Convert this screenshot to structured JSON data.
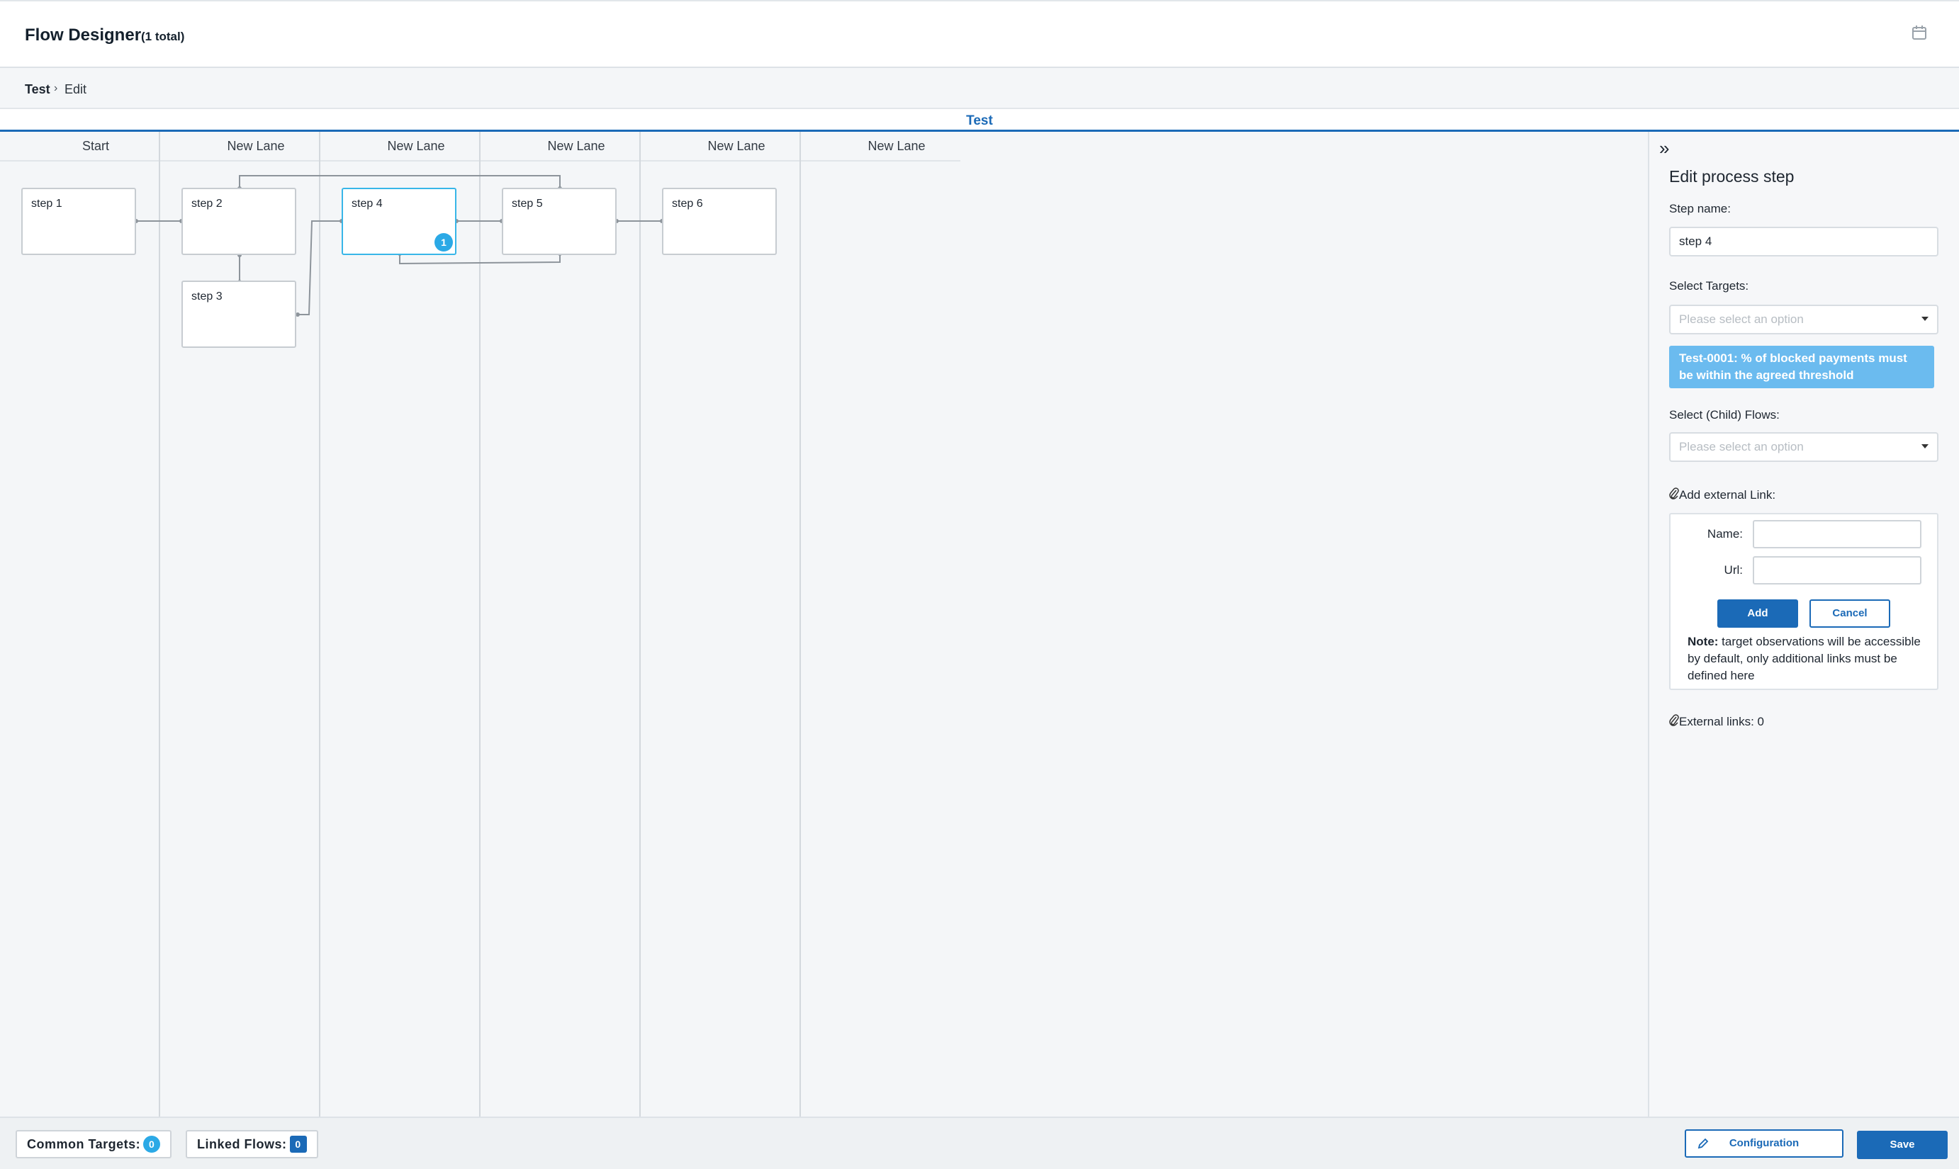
{
  "header": {
    "title": "Flow Designer",
    "count": "(1 total)",
    "calendar_icon": "calendar-icon"
  },
  "breadcrumb": {
    "current": "Test",
    "separator": "›",
    "page": "Edit"
  },
  "flow_tab": {
    "label": "Test"
  },
  "lanes": [
    {
      "label": "Start"
    },
    {
      "label": "New Lane"
    },
    {
      "label": "New Lane"
    },
    {
      "label": "New Lane"
    },
    {
      "label": "New Lane"
    },
    {
      "label": "New Lane"
    }
  ],
  "steps": {
    "step1": "step 1",
    "step2": "step 2",
    "step3": "step 3",
    "step4": "step 4",
    "step5": "step 5",
    "step6": "step 6",
    "step4_badge": "1"
  },
  "panel": {
    "collapse_icon": "»",
    "title": "Edit process step",
    "step_name_label": "Step name:",
    "step_name_value": "step 4",
    "targets_label": "Select Targets:",
    "targets_placeholder": "Please select an option",
    "selected_target": "Test-0001: % of blocked payments must be within the agreed threshold",
    "child_flows_label": "Select (Child) Flows:",
    "child_flows_placeholder": "Please select an option",
    "external_link_label": "Add external Link:",
    "name_label": "Name:",
    "url_label": "Url:",
    "add_button": "Add",
    "cancel_button": "Cancel",
    "note_bold": "Note:",
    "note_text": " target observations will be accessible by default, only additional links must be defined here",
    "external_links_label": "External links: 0"
  },
  "footer": {
    "common_targets_label": "Common Targets:",
    "common_targets_count": "0",
    "linked_flows_label": "Linked Flows:",
    "linked_flows_count": "0",
    "configuration_button": "Configuration",
    "save_button": "Save"
  },
  "colors": {
    "primary": "#1b6ab7",
    "accent": "#2ba9e6",
    "selected_border": "#38b6e8",
    "tag_bg": "#6bbbef"
  }
}
